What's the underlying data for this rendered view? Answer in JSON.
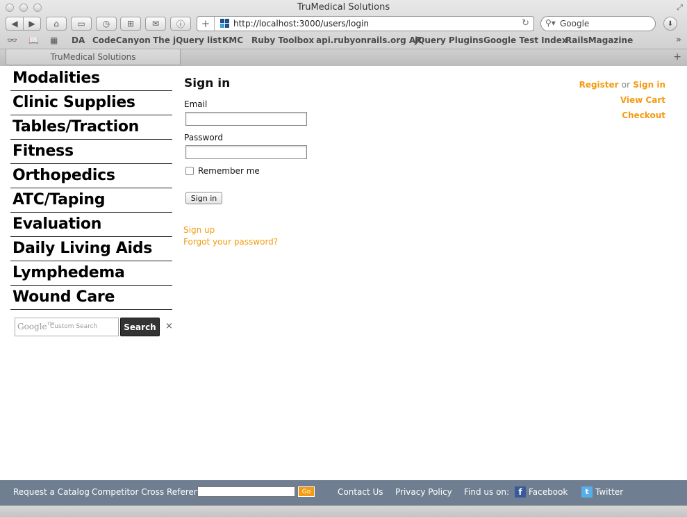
{
  "browser": {
    "window_title": "TruMedical Solutions",
    "url": "http://localhost:3000/users/login",
    "search_placeholder": "Google",
    "tab_title": "TruMedical Solutions",
    "bookmarks": [
      "DA",
      "CodeCanyon",
      "The jQuery list",
      "KMC",
      "Ruby Toolbox",
      "api.rubyonrails.org AR",
      "jQuery Plugins",
      "Google Test Index",
      "RailsMagazine"
    ]
  },
  "nav": {
    "items": [
      "Modalities",
      "Clinic Supplies",
      "Tables/Traction",
      "Fitness",
      "Orthopedics",
      "ATC/Taping",
      "Evaluation",
      "Daily Living Aids",
      "Lymphedema",
      "Wound Care"
    ]
  },
  "site_search": {
    "logo": "Google",
    "logo_tm": "TM",
    "placeholder": "Custom Search",
    "button_label": "Search",
    "clear": "×"
  },
  "signin": {
    "title": "Sign in",
    "email_label": "Email",
    "email_value": "",
    "password_label": "Password",
    "password_value": "",
    "remember_label": "Remember me",
    "remember_checked": false,
    "submit_label": "Sign in",
    "signup_link": "Sign up",
    "forgot_link": "Forgot your password?"
  },
  "account": {
    "register": "Register",
    "or": "or",
    "signin": "Sign in",
    "view_cart": "View Cart",
    "checkout": "Checkout"
  },
  "footer": {
    "request_catalog": "Request a Catalog",
    "cross_reference": "Competitor Cross Reference",
    "cross_reference_value": "",
    "go": "Go",
    "contact": "Contact Us",
    "privacy": "Privacy Policy",
    "find_us": "Find us on:",
    "facebook": "Facebook",
    "twitter": "Twitter"
  },
  "colors": {
    "link_orange": "#f39c12",
    "footer_bg": "#6f7f91",
    "search_button_bg": "#333333"
  }
}
